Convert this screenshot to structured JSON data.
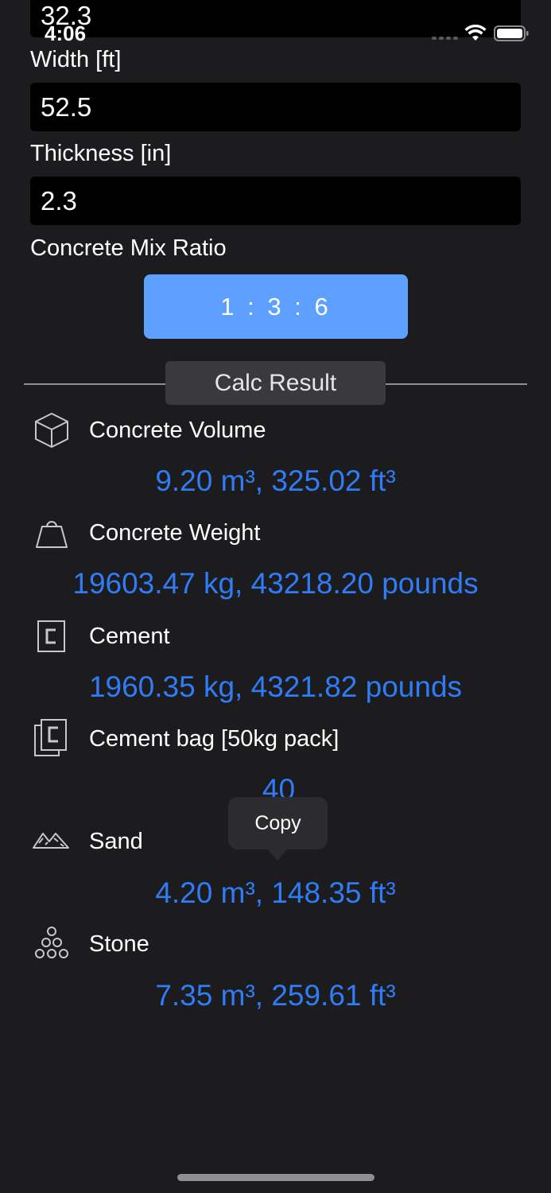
{
  "status_bar": {
    "time": "4:06"
  },
  "form": {
    "length_value": "32.3",
    "width_label": "Width [ft]",
    "width_value": "52.5",
    "thickness_label": "Thickness [in]",
    "thickness_value": "2.3",
    "mix_ratio_label": "Concrete Mix Ratio",
    "mix_ratio_value": "1 : 3 : 6"
  },
  "results": {
    "header": "Calc Result",
    "concrete_volume": {
      "label": "Concrete Volume",
      "value": "9.20 m³, 325.02 ft³",
      "icon": "cube-icon"
    },
    "concrete_weight": {
      "label": "Concrete Weight",
      "value": "19603.47 kg, 43218.20 pounds",
      "icon": "weight-icon"
    },
    "cement": {
      "label": "Cement",
      "value": "1960.35 kg, 4321.82 pounds",
      "icon": "cement-icon"
    },
    "cement_bag": {
      "label": "Cement bag [50kg pack]",
      "value": "40",
      "icon": "cement-bag-icon"
    },
    "sand": {
      "label": "Sand",
      "value": "4.20 m³, 148.35 ft³",
      "icon": "sand-pile-icon"
    },
    "stone": {
      "label": "Stone",
      "value": "7.35 m³, 259.61 ft³",
      "icon": "stones-icon"
    }
  },
  "tooltip": {
    "copy_label": "Copy"
  },
  "colors": {
    "background": "#1c1c1e",
    "accent_button": "#5ea0ff",
    "result_value": "#2f7cf6",
    "field_background": "#000000"
  }
}
